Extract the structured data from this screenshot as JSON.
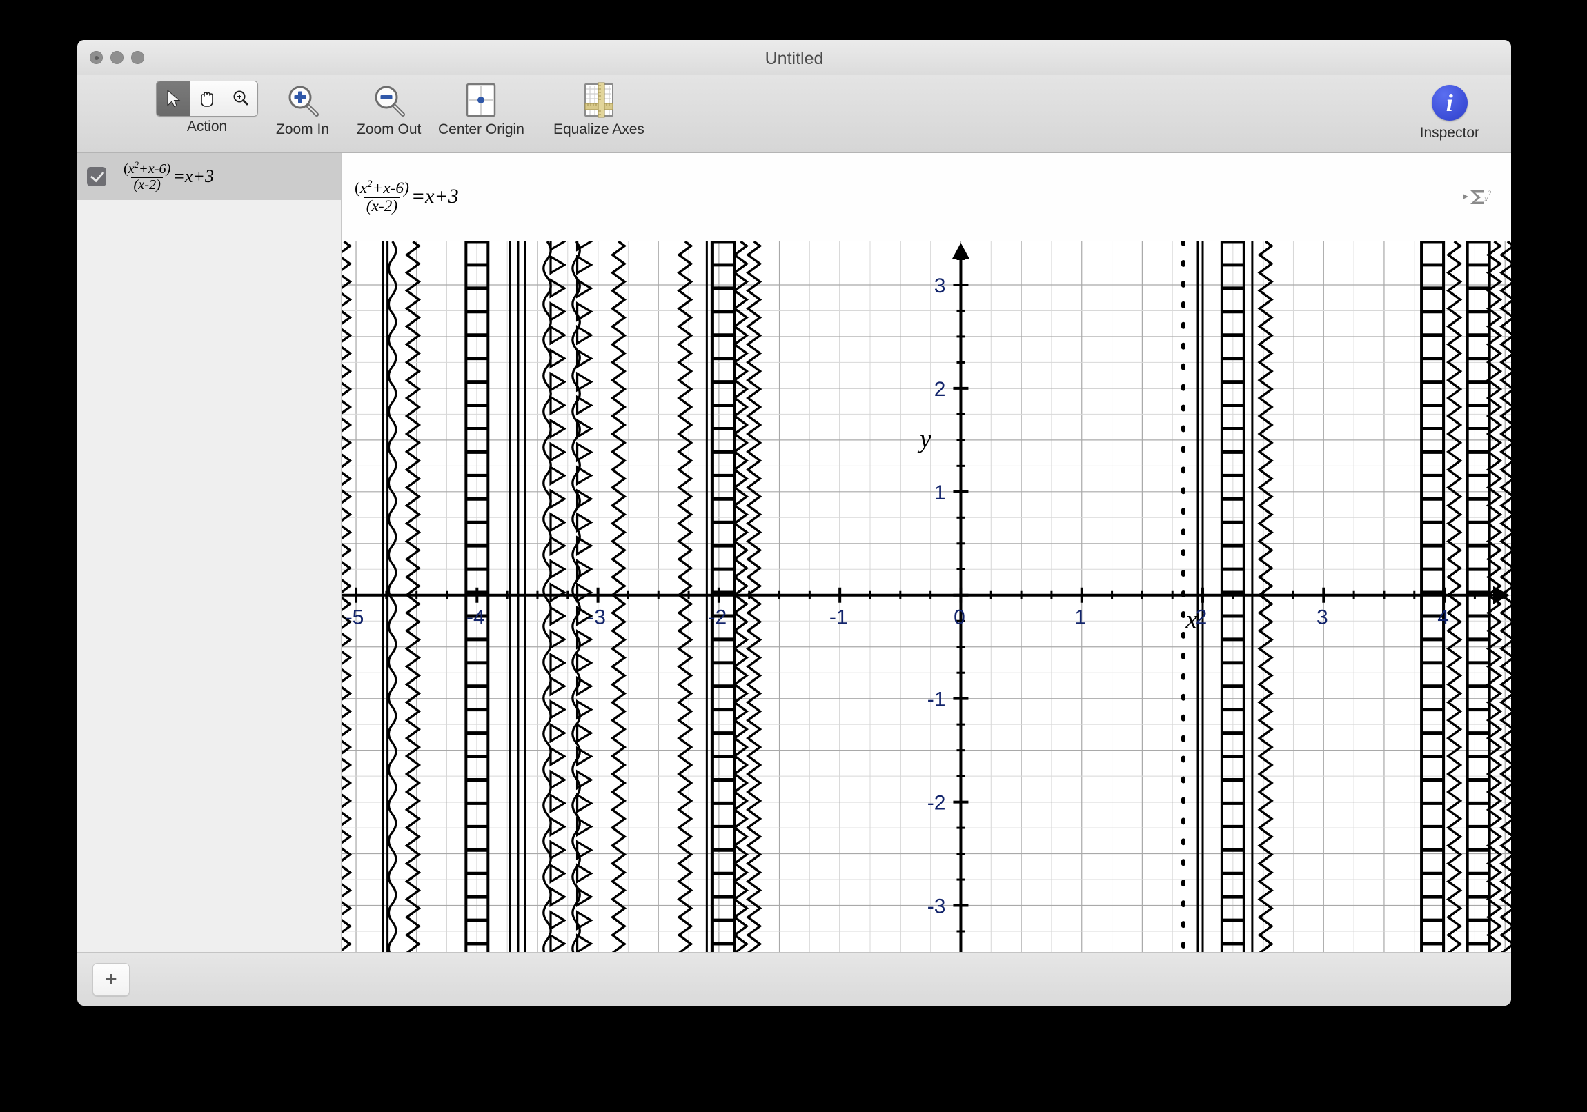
{
  "window": {
    "title": "Untitled",
    "controls": [
      "close",
      "minimize",
      "zoom"
    ]
  },
  "toolbar": {
    "action_label": "Action",
    "action_modes": [
      "arrow-cursor",
      "hand-pan",
      "magnifier-zoom"
    ],
    "action_selected": "arrow-cursor",
    "zoom_in_label": "Zoom In",
    "zoom_out_label": "Zoom Out",
    "center_origin_label": "Center Origin",
    "equalize_axes_label": "Equalize Axes",
    "inspector_label": "Inspector",
    "inspector_glyph": "i",
    "accent_color": "#3d4fd8"
  },
  "sidebar": {
    "equation_checked": true,
    "equation": {
      "numerator_pre": "(",
      "numerator_x": "x",
      "numerator_exp": "2",
      "numerator_post": "+x-6)",
      "denominator": "(x-2)",
      "rhs": "=x+3"
    }
  },
  "formula_bar": {
    "palette_icon": "sigma-x-squared-icon"
  },
  "bottom_bar": {
    "add_label": "+"
  },
  "chart_data": {
    "type": "line",
    "title": "",
    "xlabel": "x",
    "ylabel": "y",
    "equation_text": "(x^2+x-6)/(x-2) = x+3",
    "xlim": [
      -5.12,
      4.55
    ],
    "ylim": [
      -3.45,
      3.42
    ],
    "x_ticks": [
      -5,
      -4,
      -3,
      -2,
      -1,
      0,
      1,
      2,
      3,
      4
    ],
    "x_tick_labels": [
      "-5",
      "-4",
      "-3",
      "-2",
      "-1",
      "0",
      "1",
      "2",
      "3",
      "4"
    ],
    "y_ticks": [
      -3,
      -2,
      -1,
      0,
      1,
      2,
      3
    ],
    "y_tick_labels": [
      "-3",
      "-2",
      "-1",
      "0",
      "1",
      "2",
      "3"
    ],
    "minor_tick_step": 0.25,
    "grid": true,
    "grid_color": "#d8d8d8",
    "grid_major_color": "#a9a9a9",
    "axis_color": "#000000",
    "tick_label_color": "#12246b",
    "legend": "none",
    "x_axis_label_position": [
      1.86,
      -0.32
    ],
    "y_axis_label_position": [
      -0.34,
      1.43
    ],
    "note": "Rendering artifact: the relation is plotted as a dense family of near-vertical decorated curves (zigzag, wave, ladder, dotted, solid) spanning the full vertical range.",
    "artifact_lines": [
      {
        "x": -5.1,
        "style": "zigzag"
      },
      {
        "x": -4.78,
        "style": "solid"
      },
      {
        "x": -4.74,
        "style": "solid"
      },
      {
        "x": -4.7,
        "style": "wave"
      },
      {
        "x": -4.53,
        "style": "zigzag"
      },
      {
        "x": -4.0,
        "style": "ladder"
      },
      {
        "x": -3.73,
        "style": "solid"
      },
      {
        "x": -3.66,
        "style": "solid"
      },
      {
        "x": -3.6,
        "style": "solid"
      },
      {
        "x": -3.42,
        "style": "wave"
      },
      {
        "x": -3.34,
        "style": "triangle"
      },
      {
        "x": -3.18,
        "style": "wave"
      },
      {
        "x": -3.12,
        "style": "triangle"
      },
      {
        "x": -2.83,
        "style": "zigzag"
      },
      {
        "x": -2.28,
        "style": "zigzag"
      },
      {
        "x": -2.1,
        "style": "solid"
      },
      {
        "x": -2.06,
        "style": "solid"
      },
      {
        "x": -1.96,
        "style": "ladder"
      },
      {
        "x": -1.82,
        "style": "zigzag"
      },
      {
        "x": -1.71,
        "style": "zigzag"
      },
      {
        "x": 1.84,
        "style": "dotted"
      },
      {
        "x": 1.96,
        "style": "solid"
      },
      {
        "x": 2.0,
        "style": "solid"
      },
      {
        "x": 2.25,
        "style": "ladder"
      },
      {
        "x": 2.41,
        "style": "solid"
      },
      {
        "x": 2.52,
        "style": "zigzag"
      },
      {
        "x": 3.9,
        "style": "ladder"
      },
      {
        "x": 4.08,
        "style": "zigzag"
      },
      {
        "x": 4.28,
        "style": "ladder"
      },
      {
        "x": 4.41,
        "style": "zigzag"
      },
      {
        "x": 4.52,
        "style": "zigzag"
      }
    ]
  }
}
